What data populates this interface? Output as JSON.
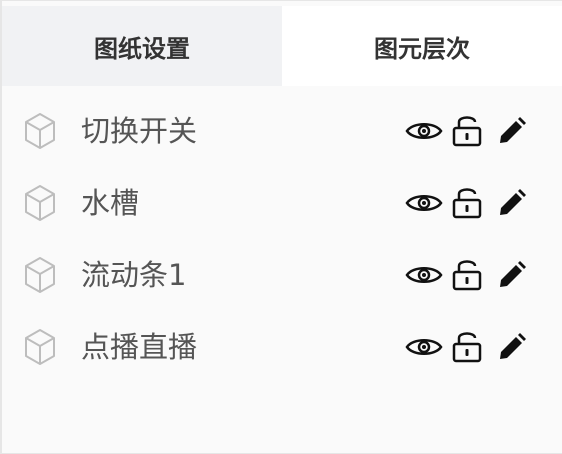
{
  "tabs": [
    {
      "label": "图纸设置",
      "active": true
    },
    {
      "label": "图元层次",
      "active": false
    }
  ],
  "layers": [
    {
      "name": "切换开关",
      "icon": "cube-icon",
      "actions": [
        "eye-icon",
        "unlock-icon",
        "pencil-icon"
      ]
    },
    {
      "name": "水槽",
      "icon": "cube-icon",
      "actions": [
        "eye-icon",
        "unlock-icon",
        "pencil-icon"
      ]
    },
    {
      "name": "流动条1",
      "icon": "cube-icon",
      "actions": [
        "eye-icon",
        "unlock-icon",
        "pencil-icon"
      ]
    },
    {
      "name": "点播直播",
      "icon": "cube-icon",
      "actions": [
        "eye-icon",
        "unlock-icon",
        "pencil-icon"
      ]
    }
  ],
  "colors": {
    "active_tab_bg": "#f1f2f4",
    "panel_bg": "#fafafa",
    "label_text": "#555555",
    "tab_text": "#333333",
    "icon_gray": "#bdbdbd",
    "icon_dark": "#111111"
  }
}
